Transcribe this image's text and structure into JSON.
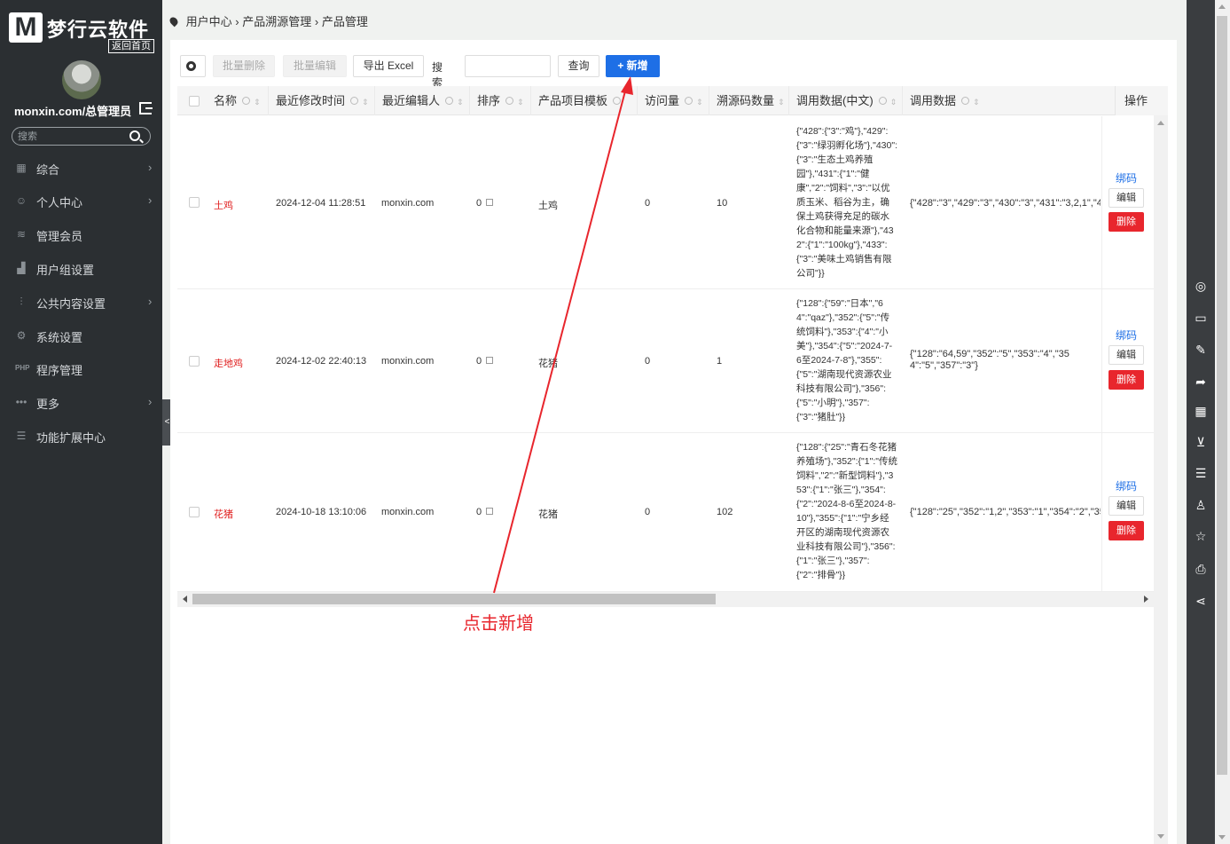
{
  "sidebar": {
    "logo_letter": "M",
    "brand": "梦行云软件",
    "home_link": "返回首页",
    "account": "monxin.com/总管理员",
    "search_placeholder": "搜索",
    "items": [
      {
        "label": "综合",
        "icon": "grid-icon",
        "chevron": "›"
      },
      {
        "label": "个人中心",
        "icon": "user-icon",
        "chevron": "›"
      },
      {
        "label": "管理会员",
        "icon": "layers-icon",
        "chevron": ""
      },
      {
        "label": "用户组设置",
        "icon": "group-icon",
        "chevron": ""
      },
      {
        "label": "公共内容设置",
        "icon": "sliders-icon",
        "chevron": "›"
      },
      {
        "label": "系统设置",
        "icon": "gear-icon",
        "chevron": ""
      },
      {
        "label": "程序管理",
        "icon": "php-icon",
        "chevron": ""
      },
      {
        "label": "更多",
        "icon": "dots-icon",
        "chevron": "›"
      },
      {
        "label": "功能扩展中心",
        "icon": "menu-icon",
        "chevron": ""
      }
    ],
    "collapse_glyph": "<"
  },
  "breadcrumb": {
    "items": [
      "用户中心",
      "产品溯源管理",
      "产品管理"
    ],
    "sep": "›"
  },
  "toolbar": {
    "batch_delete": "批量删除",
    "batch_edit": "批量编辑",
    "export_excel": "导出 Excel",
    "search_label": "搜索",
    "search_value": "",
    "query": "查询",
    "add": "+ 新增"
  },
  "table": {
    "columns": [
      "名称",
      "最近修改时间",
      "最近编辑人",
      "排序",
      "产品项目模板",
      "访问量",
      "溯源码数量",
      "调用数据(中文)",
      "调用数据"
    ],
    "ops_header": "操作",
    "rows": [
      {
        "name": "土鸡",
        "modified": "2024-12-04 11:28:51",
        "editor": "monxin.com",
        "sort": "0",
        "template": "土鸡",
        "visits": "0",
        "codes": "10",
        "data_cn": "{\"428\":{\"3\":\"鸡\"},\"429\":{\"3\":\"绿羽孵化场\"},\"430\":{\"3\":\"生态土鸡养殖园\"},\"431\":{\"1\":\"健康\",\"2\":\"饲料\",\"3\":\"以优质玉米、稻谷为主，确保土鸡获得充足的碳水化合物和能量来源\"},\"432\":{\"1\":\"100kg\"},\"433\":{\"3\":\"美味土鸡销售有限公司\"}}",
        "data": "{\"428\":\"3\",\"429\":\"3\",\"430\":\"3\",\"431\":\"3,2,1\",\"43"
      },
      {
        "name": "走地鸡",
        "modified": "2024-12-02 22:40:13",
        "editor": "monxin.com",
        "sort": "0",
        "template": "花猪",
        "visits": "0",
        "codes": "1",
        "data_cn": "{\"128\":{\"59\":\"日本\",\"64\":\"qaz\"},\"352\":{\"5\":\"传统饲料\"},\"353\":{\"4\":\"小美\"},\"354\":{\"5\":\"2024-7-6至2024-7-8\"},\"355\":{\"5\":\"湖南现代资源农业科技有限公司\"},\"356\":{\"5\":\"小明\"},\"357\":{\"3\":\"猪肚\"}}",
        "data": "{\"128\":\"64,59\",\"352\":\"5\",\"353\":\"4\",\"354\":\"5\",\"357\":\"3\"}"
      },
      {
        "name": "花猪",
        "modified": "2024-10-18 13:10:06",
        "editor": "monxin.com",
        "sort": "0",
        "template": "花猪",
        "visits": "0",
        "codes": "102",
        "data_cn": "{\"128\":{\"25\":\"青石冬花猪养殖场\"},\"352\":{\"1\":\"传统饲料\",\"2\":\"新型饲料\"},\"353\":{\"1\":\"张三\"},\"354\":{\"2\":\"2024-8-6至2024-8-10\"},\"355\":{\"1\":\"宁乡经开区的湖南现代资源农业科技有限公司\"},\"356\":{\"1\":\"张三\"},\"357\":{\"2\":\"排骨\"}}",
        "data": "{\"128\":\"25\",\"352\":\"1,2\",\"353\":\"1\",\"354\":\"2\",\"35"
      }
    ],
    "ops": {
      "bind": "绑码",
      "edit": "编辑",
      "delete": "删除"
    }
  },
  "annotation": "点击新增",
  "colors": {
    "sidebar_bg": "#2b2f32",
    "primary": "#1e6fe6",
    "danger": "#e8262d",
    "name_red": "#e02020"
  },
  "right_rail": [
    "wechat-icon",
    "comment-icon",
    "edit-icon",
    "share-arrow-icon",
    "qrcode-icon",
    "cart-icon",
    "list-icon",
    "user-icon",
    "star-icon",
    "print-icon",
    "share-icon"
  ]
}
